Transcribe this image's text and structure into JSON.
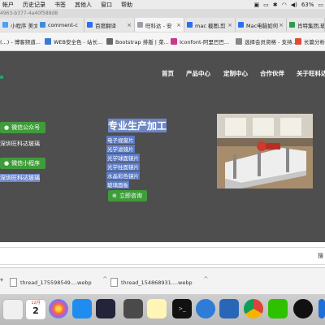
{
  "menubar": {
    "items": [
      "帐户",
      "历史记录",
      "书签",
      "其他人",
      "窗口",
      "帮助"
    ],
    "battery": "63%"
  },
  "tabs": [
    {
      "label": "小程序 美文",
      "fav_color": "#47a0ff"
    },
    {
      "label": "comment-c",
      "fav_color": "#3b8de0"
    },
    {
      "label": "百度翻译",
      "fav_color": "#2a6ff1"
    },
    {
      "label": "旺科达 - 安",
      "fav_color": "#9aa0a6"
    },
    {
      "label": "mac 截图,剪",
      "fav_color": "#2a6ff1"
    },
    {
      "label": "Mac电脑如何",
      "fav_color": "#2a6ff1"
    },
    {
      "label": "肖特集团,玻",
      "fav_color": "#2a9d4a"
    }
  ],
  "address_fragment": "4963-b377-4a40f588d8",
  "bookmarks": [
    {
      "label": "(...) - 博客频道...",
      "fav_color": "#e04a3a"
    },
    {
      "label": "WEB安全色 - 站长...",
      "fav_color": "#3a7bd5"
    },
    {
      "label": "Bootstrap 排版 | 菜...",
      "fav_color": "#666666"
    },
    {
      "label": "Iconfont-阿里巴巴...",
      "fav_color": "#c8398d"
    },
    {
      "label": "选择会员资格 - 支持...",
      "fav_color": "#888888"
    },
    {
      "label": "长篇分析",
      "fav_color": "#e04a3a"
    }
  ],
  "site": {
    "nav": [
      "首页",
      "产品中心",
      "定制中心",
      "合作伙伴",
      "关于旺科达"
    ],
    "wechat_public": "微信公众号",
    "company_1": "深圳旺科达玻璃",
    "wechat_mini": "微信小程序",
    "company_2": "深圳旺科达玻璃",
    "headline": "专业生产加工",
    "products": [
      "电子视窗片",
      "光学滤镜片",
      "光学球面镜片",
      "光学柱面镜片",
      "水晶彩色镜片",
      "玻璃面板"
    ],
    "consult_button": "立即咨询"
  },
  "search_right_char": "搜",
  "downloads": [
    {
      "label": "thread_175598549....webp"
    },
    {
      "label": "thread_154868931....webp"
    }
  ],
  "dock": {
    "calendar_month": "12月",
    "calendar_day": "2"
  },
  "colors": {
    "site_bg": "#4e4e4e",
    "green": "#3f9c3a",
    "selection": "#5a79c4"
  }
}
